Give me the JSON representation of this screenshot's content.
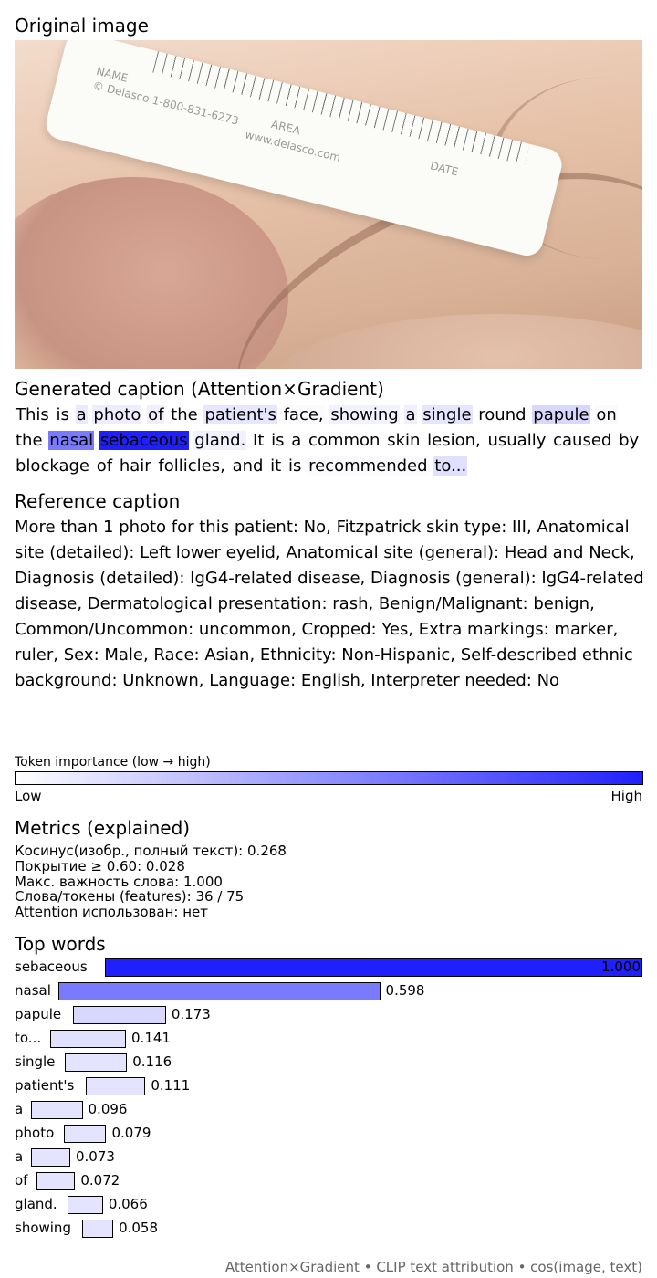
{
  "headings": {
    "original": "Original image",
    "generated": "Generated caption (Attention×Gradient)",
    "reference": "Reference caption",
    "metrics": "Metrics (explained)",
    "top_words": "Top words"
  },
  "image": {
    "ruler_text": [
      "NAME",
      "© Delasco 1-800-831-6273",
      "AREA",
      "www.delasco.com",
      "DATE"
    ]
  },
  "generated_caption": {
    "tokens": [
      {
        "text": "This",
        "w": 0
      },
      {
        "text": "is",
        "w": 0
      },
      {
        "text": "a",
        "w": 0.096
      },
      {
        "text": "photo",
        "w": 0.079
      },
      {
        "text": "of",
        "w": 0.072
      },
      {
        "text": "the",
        "w": 0
      },
      {
        "text": "patient's",
        "w": 0.111
      },
      {
        "text": "face,",
        "w": 0.02
      },
      {
        "text": "showing",
        "w": 0.058
      },
      {
        "text": "a",
        "w": 0.073
      },
      {
        "text": "single",
        "w": 0.116
      },
      {
        "text": "round",
        "w": 0
      },
      {
        "text": "papule",
        "w": 0.173
      },
      {
        "text": "on",
        "w": 0.02
      },
      {
        "text": "the",
        "w": 0
      },
      {
        "text": "nasal",
        "w": 0.598
      },
      {
        "text": "sebaceous",
        "w": 1.0
      },
      {
        "text": "gland.",
        "w": 0.066
      },
      {
        "text": "It",
        "w": 0
      },
      {
        "text": "is",
        "w": 0
      },
      {
        "text": "a",
        "w": 0
      },
      {
        "text": "common",
        "w": 0
      },
      {
        "text": "skin",
        "w": 0
      },
      {
        "text": "lesion,",
        "w": 0
      },
      {
        "text": "usually",
        "w": 0
      },
      {
        "text": "caused",
        "w": 0
      },
      {
        "text": "by",
        "w": 0
      },
      {
        "text": "blockage",
        "w": 0
      },
      {
        "text": "of",
        "w": 0
      },
      {
        "text": "hair",
        "w": 0
      },
      {
        "text": "follicles,",
        "w": 0
      },
      {
        "text": "and",
        "w": 0
      },
      {
        "text": "it",
        "w": 0
      },
      {
        "text": "is",
        "w": 0
      },
      {
        "text": "recommended",
        "w": 0.02
      },
      {
        "text": "to...",
        "w": 0.141
      }
    ]
  },
  "reference_caption": "More than 1 photo for this patient: No, Fitzpatrick skin type: III, Anatomical site (detailed): Left lower eyelid, Anatomical site (general): Head and Neck, Diagnosis (detailed): IgG4-related disease, Diagnosis (general): IgG4-related disease, Dermatological presentation: rash, Benign/Malignant: benign, Common/Uncommon: uncommon, Cropped: Yes, Extra markings: marker, ruler, Sex: Male, Race: Asian, Ethnicity: Non-Hispanic, Self-described ethnic background: Unknown, Language: English, Interpreter needed: No",
  "colorbar": {
    "title": "Token importance (low → high)",
    "low": "Low",
    "high": "High",
    "color_low": "#ffffff",
    "color_high": "#2020ff"
  },
  "metrics": [
    "Косинус(изобр., полный текст): 0.268",
    "Покрытие ≥ 0.60: 0.028",
    "Макс. важность слова: 1.000",
    "Слова/токены (features): 36 / 75",
    "Attention использован: нет"
  ],
  "chart_data": {
    "type": "bar",
    "categories": [
      "sebaceous",
      "nasal",
      "papule",
      "to...",
      "single",
      "patient's",
      "a",
      "photo",
      "a",
      "of",
      "gland.",
      "showing"
    ],
    "values": [
      1.0,
      0.598,
      0.173,
      0.141,
      0.116,
      0.111,
      0.096,
      0.079,
      0.073,
      0.072,
      0.066,
      0.058
    ],
    "value_labels": [
      "1.000",
      "0.598",
      "0.173",
      "0.141",
      "0.116",
      "0.111",
      "0.096",
      "0.079",
      "0.073",
      "0.072",
      "0.066",
      "0.058"
    ],
    "bar_starts": [
      0.1436,
      0.07,
      0.0929,
      0.0566,
      0.0798,
      0.1133,
      0.0261,
      0.0784,
      0.0261,
      0.0348,
      0.0842,
      0.1074
    ],
    "xlim": [
      0,
      1
    ],
    "title": "Top words",
    "color_low": "#ffffff",
    "color_high": "#2020ff"
  },
  "footer": "Attention×Gradient • CLIP text attribution • cos(image, text)"
}
